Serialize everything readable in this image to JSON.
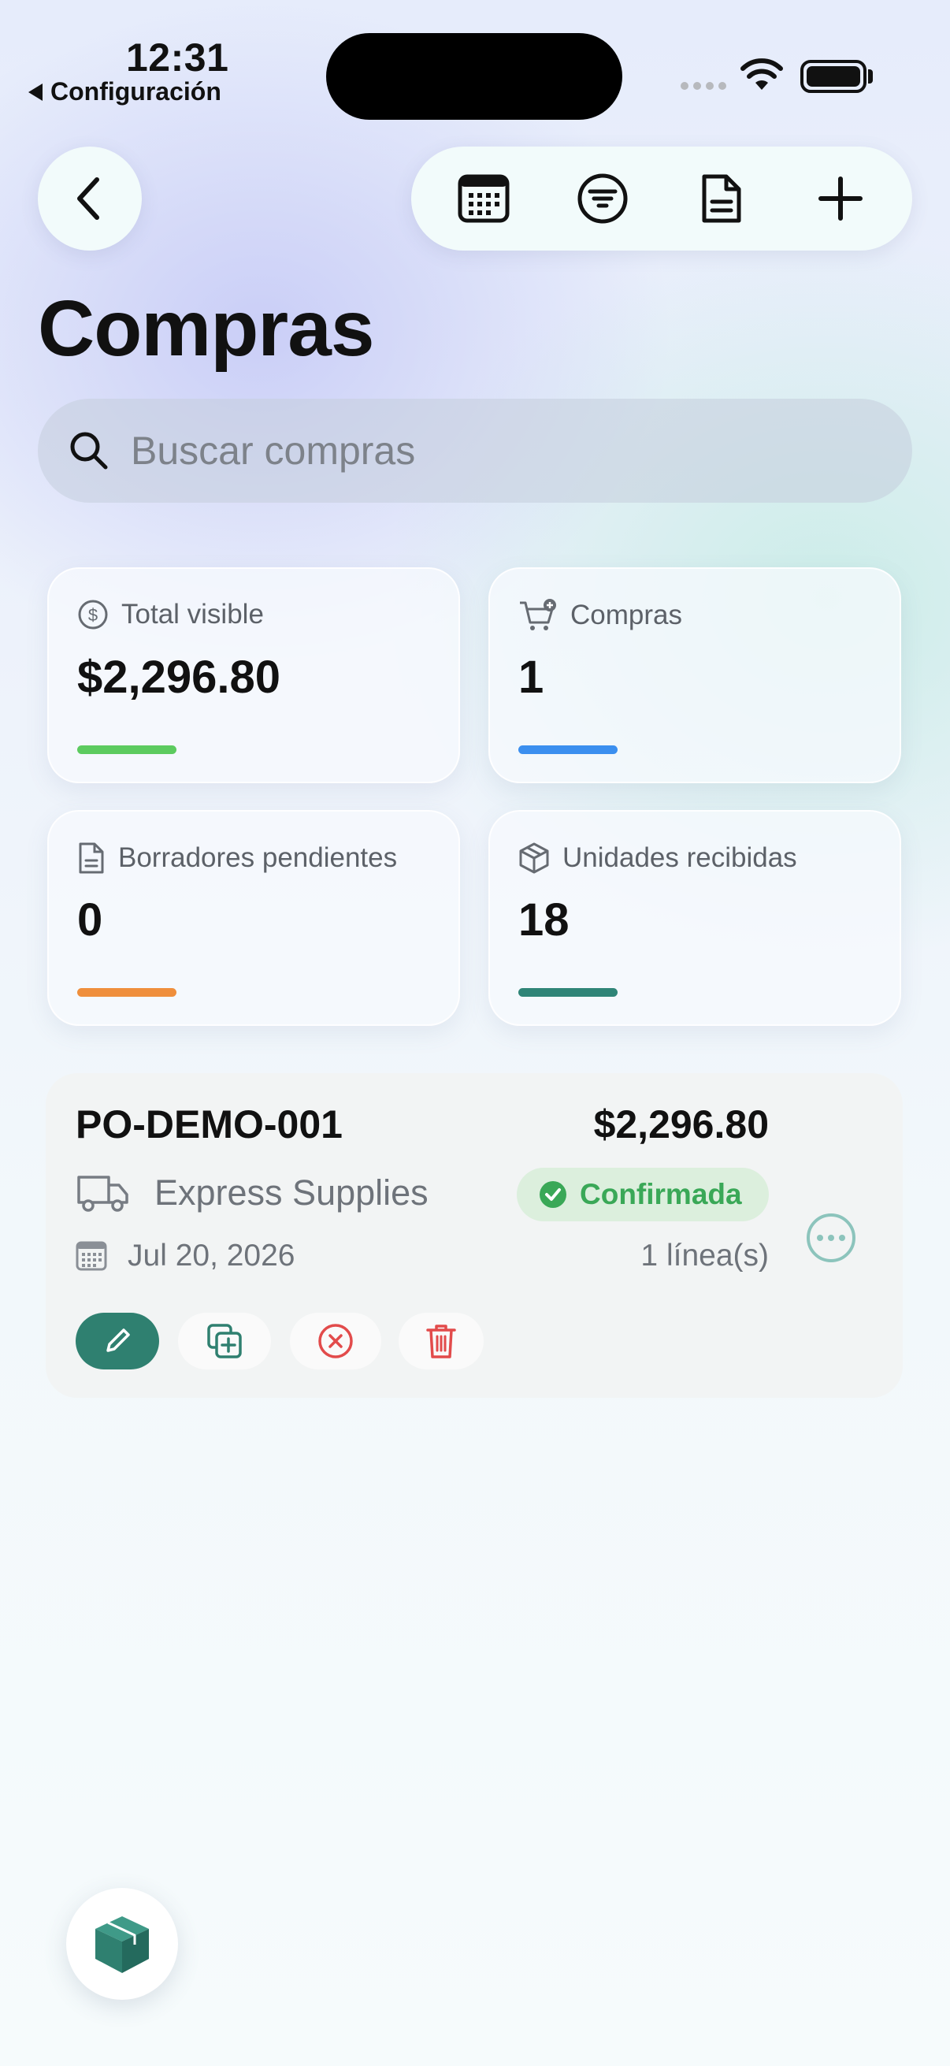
{
  "status_bar": {
    "time": "12:31",
    "back_app": "Configuración",
    "icons": [
      "cellular-signal-icon",
      "wifi-icon",
      "battery-icon"
    ]
  },
  "nav": {
    "back_icon": "chevron-left-icon",
    "toolbar_icons": [
      "calendar-icon",
      "filter-icon",
      "document-icon",
      "plus-icon"
    ]
  },
  "page": {
    "title": "Compras"
  },
  "search": {
    "placeholder": "Buscar compras",
    "value": ""
  },
  "stats": {
    "total_visible": {
      "label": "Total visible",
      "value": "$2,296.80",
      "icon": "dollar-circle-icon",
      "accent": "#5ccb5f"
    },
    "compras": {
      "label": "Compras",
      "value": "1",
      "icon": "cart-plus-icon",
      "accent": "#3b8fef"
    },
    "borradores": {
      "label": "Borradores pendientes",
      "value": "0",
      "icon": "document-icon",
      "accent": "#ef8f3c"
    },
    "unidades": {
      "label": "Unidades recibidas",
      "value": "18",
      "icon": "box-icon",
      "accent": "#2f8577"
    }
  },
  "purchase": {
    "id": "PO-DEMO-001",
    "amount": "$2,296.80",
    "supplier": "Express Supplies",
    "status": "Confirmada",
    "status_color": "#3aa857",
    "date": "Jul 20, 2026",
    "lines": "1 línea(s)",
    "actions": [
      "edit",
      "duplicate",
      "cancel",
      "delete"
    ]
  },
  "fab": {
    "icon": "cube-icon"
  }
}
